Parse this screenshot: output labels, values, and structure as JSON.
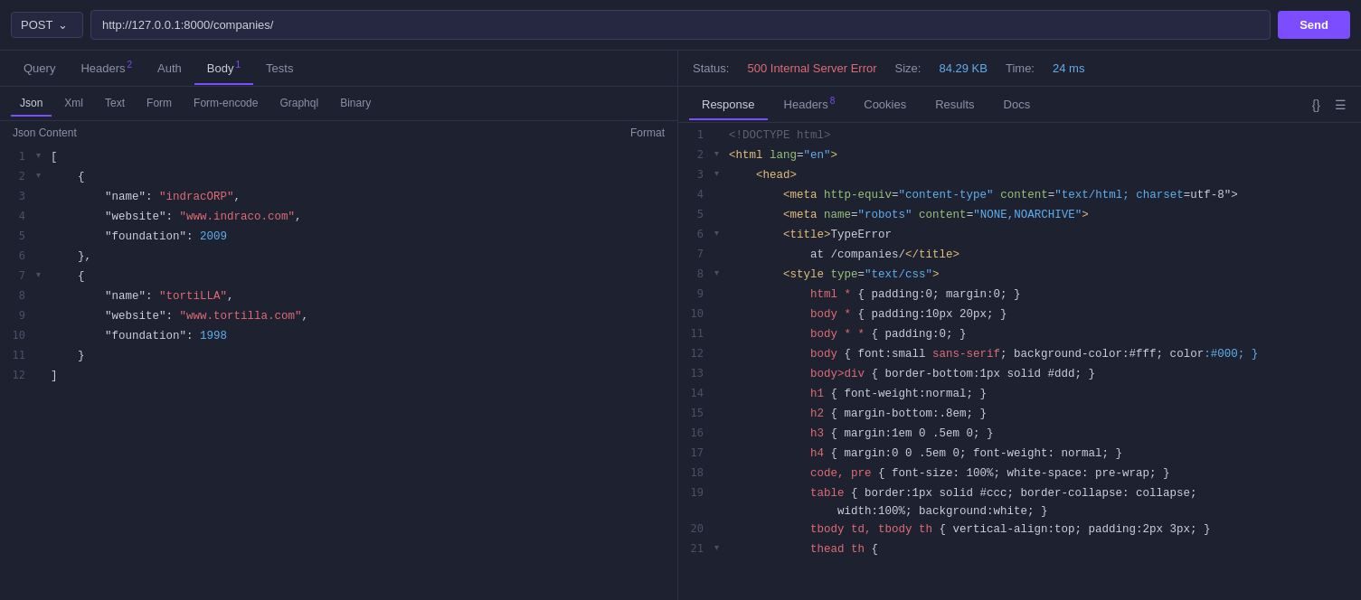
{
  "topbar": {
    "method": "POST",
    "url": "http://127.0.0.1:8000/companies/",
    "send_label": "Send"
  },
  "left": {
    "tabs": [
      {
        "label": "Query",
        "badge": null,
        "active": false
      },
      {
        "label": "Headers",
        "badge": "2",
        "active": false
      },
      {
        "label": "Auth",
        "badge": null,
        "active": false
      },
      {
        "label": "Body",
        "badge": "1",
        "active": true
      },
      {
        "label": "Tests",
        "badge": null,
        "active": false
      }
    ],
    "sub_tabs": [
      {
        "label": "Json",
        "active": true
      },
      {
        "label": "Xml",
        "active": false
      },
      {
        "label": "Text",
        "active": false
      },
      {
        "label": "Form",
        "active": false
      },
      {
        "label": "Form-encode",
        "active": false
      },
      {
        "label": "Graphql",
        "active": false
      },
      {
        "label": "Binary",
        "active": false
      }
    ],
    "json_title": "Json Content",
    "format_label": "Format",
    "code_lines": [
      {
        "num": 1,
        "toggle": "▾",
        "content": "["
      },
      {
        "num": 2,
        "toggle": "▾",
        "content": "    {"
      },
      {
        "num": 3,
        "toggle": null,
        "content": "        \"name\": \"indracORP\","
      },
      {
        "num": 4,
        "toggle": null,
        "content": "        \"website\": \"www.indraco.com\","
      },
      {
        "num": 5,
        "toggle": null,
        "content": "        \"foundation\": 2009"
      },
      {
        "num": 6,
        "toggle": null,
        "content": "    },"
      },
      {
        "num": 7,
        "toggle": "▾",
        "content": "    {"
      },
      {
        "num": 8,
        "toggle": null,
        "content": "        \"name\": \"tortiLLA\","
      },
      {
        "num": 9,
        "toggle": null,
        "content": "        \"website\": \"www.tortilla.com\","
      },
      {
        "num": 10,
        "toggle": null,
        "content": "        \"foundation\": 1998"
      },
      {
        "num": 11,
        "toggle": null,
        "content": "    }"
      },
      {
        "num": 12,
        "toggle": null,
        "content": "]"
      }
    ]
  },
  "right": {
    "status": {
      "status_label": "Status:",
      "status_value": "500 Internal Server Error",
      "size_label": "Size:",
      "size_value": "84.29 KB",
      "time_label": "Time:",
      "time_value": "24 ms"
    },
    "tabs": [
      {
        "label": "Response",
        "badge": null,
        "active": true
      },
      {
        "label": "Headers",
        "badge": "8",
        "active": false
      },
      {
        "label": "Cookies",
        "badge": null,
        "active": false
      },
      {
        "label": "Results",
        "badge": null,
        "active": false
      },
      {
        "label": "Docs",
        "badge": null,
        "active": false
      }
    ],
    "response_lines": [
      {
        "num": 1,
        "toggle": null,
        "content": "<!DOCTYPE html>",
        "type": "comment"
      },
      {
        "num": 2,
        "toggle": "▾",
        "content": "<html lang=\"en\">",
        "type": "tag"
      },
      {
        "num": 3,
        "toggle": "▾",
        "content": "    <head>",
        "type": "tag"
      },
      {
        "num": 4,
        "toggle": null,
        "content": "        <meta http-equiv=\"content-type\" content=\"text/html; charset=utf-8\">",
        "type": "tag"
      },
      {
        "num": 5,
        "toggle": null,
        "content": "        <meta name=\"robots\" content=\"NONE,NOARCHIVE\">",
        "type": "tag"
      },
      {
        "num": 6,
        "toggle": "▾",
        "content": "        <title>TypeError",
        "type": "tag_text"
      },
      {
        "num": 7,
        "toggle": null,
        "content": "            at /companies/</title>",
        "type": "tag"
      },
      {
        "num": 8,
        "toggle": "▾",
        "content": "        <style type=\"text/css\">",
        "type": "tag"
      },
      {
        "num": 9,
        "toggle": null,
        "content": "            html * { padding:0; margin:0; }",
        "type": "css"
      },
      {
        "num": 10,
        "toggle": null,
        "content": "            body * { padding:10px 20px; }",
        "type": "css"
      },
      {
        "num": 11,
        "toggle": null,
        "content": "            body * * { padding:0; }",
        "type": "css"
      },
      {
        "num": 12,
        "toggle": null,
        "content": "            body { font:small sans-serif; background-color:#fff; color:#000; }",
        "type": "css"
      },
      {
        "num": 13,
        "toggle": null,
        "content": "            body>div { border-bottom:1px solid #ddd; }",
        "type": "css"
      },
      {
        "num": 14,
        "toggle": null,
        "content": "            h1 { font-weight:normal; }",
        "type": "css"
      },
      {
        "num": 15,
        "toggle": null,
        "content": "            h2 { margin-bottom:.8em; }",
        "type": "css"
      },
      {
        "num": 16,
        "toggle": null,
        "content": "            h3 { margin:1em 0 .5em 0; }",
        "type": "css"
      },
      {
        "num": 17,
        "toggle": null,
        "content": "            h4 { margin:0 0 .5em 0; font-weight: normal; }",
        "type": "css"
      },
      {
        "num": 18,
        "toggle": null,
        "content": "            code, pre { font-size: 100%; white-space: pre-wrap; }",
        "type": "css"
      },
      {
        "num": 19,
        "toggle": null,
        "content": "            table { border:1px solid #ccc; border-collapse: collapse; width:100%; background:white; }",
        "type": "css"
      },
      {
        "num": 20,
        "toggle": null,
        "content": "            tbody td, tbody th { vertical-align:top; padding:2px 3px; }",
        "type": "css"
      },
      {
        "num": 21,
        "toggle": "▾",
        "content": "            thead th {",
        "type": "css"
      }
    ]
  }
}
